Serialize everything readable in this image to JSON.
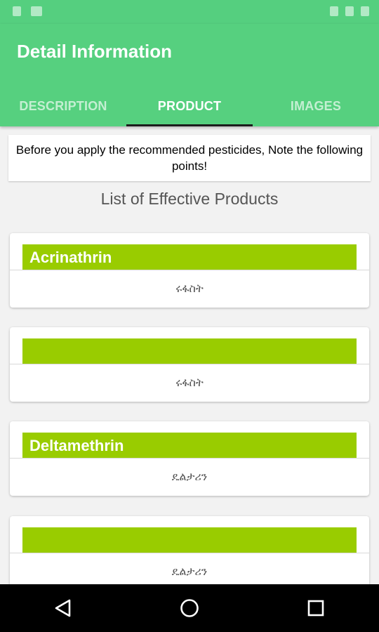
{
  "app_bar": {
    "title": "Detail Information",
    "tabs": [
      {
        "label": "DESCRIPTION",
        "active": false
      },
      {
        "label": "PRODUCT",
        "active": true
      },
      {
        "label": "IMAGES",
        "active": false
      }
    ]
  },
  "notice": {
    "text": "Before you apply the recommended pesticides, Note the following points!"
  },
  "list": {
    "heading": "List of Effective Products",
    "items": [
      {
        "name": "Acrinathrin",
        "subtitle": "ሩፋስት"
      },
      {
        "name": "",
        "subtitle": "ሩፋስት"
      },
      {
        "name": "Deltamethrin",
        "subtitle": "ዴልታሪን"
      },
      {
        "name": "",
        "subtitle": "ዴልታሪን"
      }
    ]
  },
  "colors": {
    "app_bar": "#56d07f",
    "product_band": "#99cc00",
    "tab_indicator": "#1d1d1d"
  },
  "icons": {
    "status_left": [
      "sim-icon",
      "notification-icon"
    ],
    "status_right": [
      "wifi-icon",
      "signal-icon",
      "battery-icon"
    ],
    "nav": [
      "back-icon",
      "home-icon",
      "recents-icon"
    ]
  }
}
